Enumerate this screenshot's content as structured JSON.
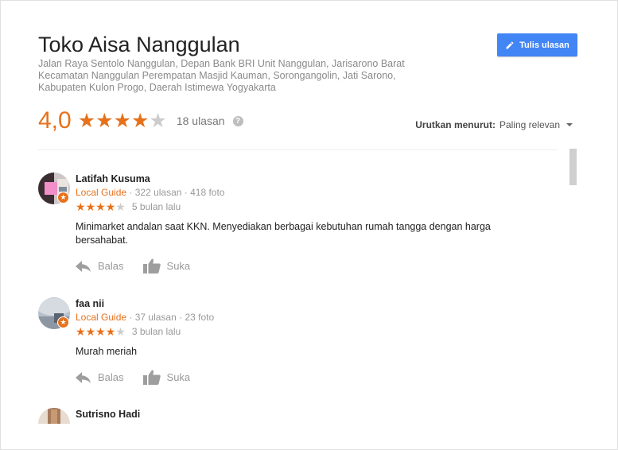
{
  "place": {
    "name": "Toko Aisa Nanggulan",
    "address": "Jalan Raya Sentolo Nanggulan, Depan Bank BRI Unit Nanggulan, Jarisarono Barat Kecamatan Nanggulan Perempatan Masjid Kauman, Sorongangolin, Jati Sarono, Kabupaten Kulon Progo, Daerah Istimewa Yogyakarta"
  },
  "write_review": {
    "label": "Tulis ulasan",
    "icon": "pencil-icon"
  },
  "summary": {
    "rating_text": "4,0",
    "rating": 4.0,
    "max": 5,
    "count_text": "18 ulasan",
    "help_icon": "help-icon"
  },
  "sort": {
    "label": "Urutkan menurut:",
    "value": "Paling relevan",
    "icon": "caret-down-icon"
  },
  "colors": {
    "accent": "#e7711b",
    "primary_button": "#4285f4",
    "star_empty": "#cccccc",
    "muted": "#999999"
  },
  "actions": {
    "reply": "Balas",
    "like": "Suka",
    "reply_icon": "reply-icon",
    "like_icon": "thumbs-up-icon"
  },
  "reviews": [
    {
      "name": "Latifah Kusuma",
      "guide": "Local Guide",
      "reviews_count": "322 ulasan",
      "photos": "418 foto",
      "stars": 4,
      "time": "5 bulan lalu",
      "text": "Minimarket andalan saat KKN. Menyediakan berbagai kebutuhan rumah tangga dengan harga bersahabat."
    },
    {
      "name": "faa nii",
      "guide": "Local Guide",
      "reviews_count": "37 ulasan",
      "photos": "23 foto",
      "stars": 4,
      "time": "3 bulan lalu",
      "text": "Murah meriah"
    },
    {
      "name": "Sutrisno Hadi"
    }
  ]
}
